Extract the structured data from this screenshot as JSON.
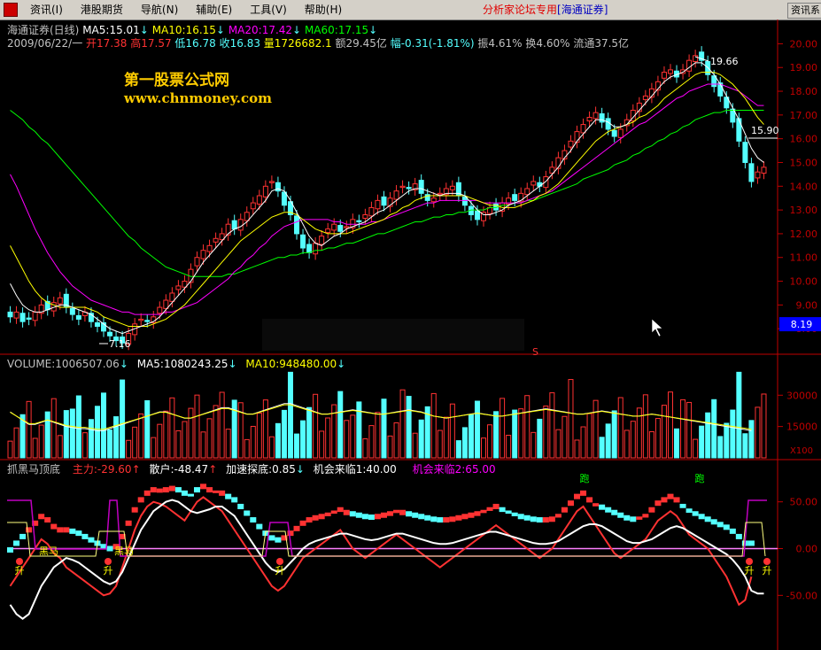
{
  "menu": {
    "items": [
      "资讯(I)",
      "港股期货",
      "导航(N)",
      "辅助(E)",
      "工具(V)",
      "帮助(H)"
    ],
    "title": "分析家论坛专用",
    "broker": "[海通证券]",
    "right_button": "资讯系"
  },
  "colors": {
    "up": "#ff3232",
    "down": "#54ffff",
    "ma5": "#ffffff",
    "ma10": "#ffff00",
    "ma20": "#ff00ff",
    "ma60": "#00ff00",
    "axis": "#c00000"
  },
  "price_header": {
    "name": "海通证券(日线)",
    "ma5": "MA5:15.01",
    "ma10": "MA10:16.15",
    "ma20": "MA20:17.42",
    "ma60": "MA60:17.15"
  },
  "quote_line": {
    "date": "2009/06/22/一",
    "open": "开17.38",
    "high": "高17.57",
    "low": "低16.78",
    "close": "收16.83",
    "vol": "量1726682.1",
    "amount": "额29.45亿",
    "change": "幅-0.31(-1.81%)",
    "amp": "振4.61%",
    "turn": "换4.60%",
    "float": "流通37.5亿"
  },
  "watermark": {
    "cn": "第一股票公式网",
    "url": "www.chnmoney.com"
  },
  "price_axis": {
    "labels": [
      "20.00",
      "19.00",
      "18.00",
      "17.00",
      "16.00",
      "15.00",
      "14.00",
      "13.00",
      "12.00",
      "11.00",
      "10.00",
      "9.00",
      "8.00"
    ],
    "current": "8.19"
  },
  "annotations": {
    "high": "19.66",
    "low": "7.16",
    "mid": "15.90",
    "s_mark": "S"
  },
  "volume_header": {
    "vol": "VOLUME:1006507.06",
    "ma5": "MA5:1080243.25",
    "ma10": "MA10:948480.00"
  },
  "volume_axis": {
    "labels": [
      "30000",
      "15000"
    ],
    "unit": "X100"
  },
  "ind_header": {
    "name": "抓黑马顶底",
    "main": "主力:-29.60",
    "retail": "散户:-48.47",
    "accel": "加速探底:0.85",
    "chance1": "机会来临1:40.00",
    "chance2": "机会来临2:65.00"
  },
  "ind_axis": {
    "labels": [
      "50.00",
      "0.00",
      "-50.00"
    ]
  },
  "ind_marks": {
    "sheng": "升",
    "heima": "黑马",
    "pao": "跑"
  },
  "chart_data": {
    "type": "candlestick",
    "y_range": [
      7.0,
      20.5
    ],
    "candles_close": [
      8.5,
      8.7,
      8.3,
      8.4,
      8.7,
      9.0,
      8.8,
      9.1,
      9.3,
      8.9,
      8.6,
      8.4,
      8.7,
      8.3,
      8.1,
      7.9,
      7.7,
      7.5,
      7.4,
      7.8,
      8.2,
      8.4,
      8.3,
      8.5,
      8.9,
      9.2,
      9.5,
      9.8,
      10.0,
      10.5,
      11.0,
      11.3,
      11.5,
      11.8,
      12.0,
      12.4,
      12.2,
      12.6,
      12.9,
      13.3,
      13.6,
      14.0,
      14.2,
      13.8,
      13.2,
      12.8,
      12.0,
      11.4,
      11.2,
      11.6,
      11.9,
      12.2,
      12.4,
      12.1,
      12.3,
      12.6,
      12.5,
      12.8,
      13.1,
      13.4,
      13.2,
      13.5,
      13.8,
      14.0,
      13.9,
      14.1,
      13.7,
      13.4,
      13.5,
      13.7,
      13.9,
      14.0,
      13.6,
      13.2,
      12.8,
      12.6,
      12.9,
      13.1,
      13.0,
      13.3,
      13.5,
      13.4,
      13.7,
      13.9,
      14.2,
      14.0,
      14.4,
      14.8,
      15.2,
      15.5,
      15.9,
      16.3,
      16.6,
      16.9,
      17.1,
      16.7,
      16.4,
      16.1,
      16.4,
      16.8,
      17.2,
      17.5,
      17.8,
      18.1,
      18.4,
      18.8,
      18.9,
      18.6,
      18.9,
      19.3,
      19.5,
      19.3,
      18.7,
      18.2,
      17.8,
      17.3,
      16.7,
      15.9,
      15.0,
      14.2,
      14.6,
      14.8
    ],
    "ma5": [
      9.9,
      9.4,
      9.0,
      8.8,
      8.7,
      8.7,
      8.8,
      8.9,
      9.0,
      9.0,
      8.9,
      8.8,
      8.7,
      8.6,
      8.4,
      8.2,
      8.0,
      7.9,
      7.8,
      7.9,
      8.0,
      8.1,
      8.2,
      8.3,
      8.5,
      8.8,
      9.1,
      9.4,
      9.7,
      10.0,
      10.4,
      10.8,
      11.1,
      11.4,
      11.7,
      12.0,
      12.2,
      12.3,
      12.5,
      12.8,
      13.1,
      13.4,
      13.8,
      13.9,
      13.8,
      13.4,
      12.9,
      12.4,
      11.9,
      11.6,
      11.5,
      11.7,
      11.9,
      12.0,
      12.2,
      12.3,
      12.4,
      12.5,
      12.7,
      12.9,
      13.0,
      13.2,
      13.4,
      13.6,
      13.8,
      13.9,
      13.9,
      13.8,
      13.7,
      13.6,
      13.7,
      13.7,
      13.7,
      13.6,
      13.3,
      13.0,
      12.8,
      12.8,
      12.9,
      13.0,
      13.2,
      13.3,
      13.4,
      13.6,
      13.8,
      14.0,
      14.2,
      14.5,
      14.8,
      15.2,
      15.5,
      15.9,
      16.2,
      16.5,
      16.8,
      16.8,
      16.7,
      16.5,
      16.5,
      16.6,
      16.9,
      17.2,
      17.5,
      17.8,
      18.1,
      18.4,
      18.6,
      18.7,
      18.8,
      19.0,
      19.2,
      19.2,
      19.0,
      18.7,
      18.3,
      17.8,
      17.3,
      16.8,
      16.2,
      15.6,
      15.2,
      15.0
    ],
    "ma10": [
      11.5,
      11.0,
      10.5,
      10.0,
      9.6,
      9.3,
      9.1,
      9.0,
      8.9,
      8.9,
      8.9,
      8.9,
      8.9,
      8.8,
      8.7,
      8.5,
      8.4,
      8.3,
      8.2,
      8.1,
      8.1,
      8.1,
      8.1,
      8.2,
      8.3,
      8.4,
      8.6,
      8.8,
      9.0,
      9.3,
      9.6,
      9.9,
      10.2,
      10.5,
      10.8,
      11.1,
      11.4,
      11.7,
      11.9,
      12.1,
      12.3,
      12.5,
      12.7,
      12.8,
      12.9,
      12.9,
      12.8,
      12.6,
      12.4,
      12.2,
      12.1,
      12.0,
      12.0,
      12.0,
      12.0,
      12.1,
      12.2,
      12.3,
      12.4,
      12.5,
      12.6,
      12.8,
      12.9,
      13.1,
      13.2,
      13.4,
      13.5,
      13.6,
      13.6,
      13.6,
      13.6,
      13.6,
      13.6,
      13.6,
      13.5,
      13.4,
      13.3,
      13.2,
      13.2,
      13.1,
      13.1,
      13.1,
      13.2,
      13.3,
      13.4,
      13.6,
      13.7,
      13.9,
      14.1,
      14.4,
      14.7,
      15.0,
      15.3,
      15.6,
      15.9,
      16.1,
      16.3,
      16.4,
      16.5,
      16.6,
      16.7,
      16.9,
      17.0,
      17.2,
      17.4,
      17.7,
      17.9,
      18.1,
      18.3,
      18.5,
      18.7,
      18.8,
      18.8,
      18.8,
      18.7,
      18.5,
      18.3,
      18.0,
      17.7,
      17.3,
      16.9,
      16.6
    ],
    "ma20": [
      14.5,
      14.0,
      13.4,
      12.8,
      12.2,
      11.7,
      11.2,
      10.8,
      10.4,
      10.1,
      9.8,
      9.6,
      9.4,
      9.2,
      9.1,
      9.0,
      8.9,
      8.8,
      8.7,
      8.7,
      8.6,
      8.6,
      8.6,
      8.6,
      8.6,
      8.7,
      8.7,
      8.8,
      8.9,
      9.0,
      9.1,
      9.3,
      9.5,
      9.7,
      9.9,
      10.1,
      10.4,
      10.6,
      10.9,
      11.1,
      11.4,
      11.6,
      11.9,
      12.1,
      12.3,
      12.4,
      12.5,
      12.6,
      12.6,
      12.6,
      12.6,
      12.6,
      12.5,
      12.5,
      12.4,
      12.4,
      12.4,
      12.4,
      12.5,
      12.5,
      12.6,
      12.7,
      12.8,
      12.9,
      13.0,
      13.1,
      13.2,
      13.3,
      13.3,
      13.4,
      13.4,
      13.4,
      13.4,
      13.4,
      13.4,
      13.4,
      13.3,
      13.3,
      13.3,
      13.3,
      13.3,
      13.3,
      13.3,
      13.4,
      13.5,
      13.6,
      13.7,
      13.8,
      14.0,
      14.2,
      14.4,
      14.6,
      14.8,
      15.0,
      15.2,
      15.4,
      15.6,
      15.8,
      16.0,
      16.2,
      16.4,
      16.6,
      16.7,
      16.9,
      17.1,
      17.3,
      17.5,
      17.7,
      17.8,
      18.0,
      18.1,
      18.2,
      18.3,
      18.3,
      18.3,
      18.2,
      18.1,
      18.0,
      17.8,
      17.6,
      17.4,
      17.4
    ],
    "ma60": [
      17.2,
      17.0,
      16.8,
      16.5,
      16.3,
      16.0,
      15.8,
      15.5,
      15.2,
      14.9,
      14.6,
      14.3,
      14.0,
      13.7,
      13.4,
      13.1,
      12.8,
      12.5,
      12.2,
      11.9,
      11.7,
      11.4,
      11.2,
      11.0,
      10.8,
      10.6,
      10.5,
      10.4,
      10.3,
      10.2,
      10.2,
      10.2,
      10.2,
      10.2,
      10.2,
      10.3,
      10.3,
      10.4,
      10.5,
      10.6,
      10.7,
      10.8,
      10.9,
      11.0,
      11.0,
      11.1,
      11.1,
      11.2,
      11.2,
      11.3,
      11.3,
      11.4,
      11.4,
      11.5,
      11.6,
      11.6,
      11.7,
      11.8,
      11.9,
      12.0,
      12.0,
      12.1,
      12.2,
      12.3,
      12.4,
      12.5,
      12.5,
      12.6,
      12.7,
      12.7,
      12.8,
      12.8,
      12.9,
      12.9,
      13.0,
      13.0,
      13.0,
      13.1,
      13.1,
      13.2,
      13.2,
      13.3,
      13.3,
      13.4,
      13.4,
      13.5,
      13.6,
      13.7,
      13.8,
      13.9,
      14.0,
      14.1,
      14.3,
      14.4,
      14.5,
      14.6,
      14.7,
      14.9,
      15.0,
      15.1,
      15.3,
      15.4,
      15.6,
      15.7,
      15.9,
      16.0,
      16.2,
      16.3,
      16.5,
      16.6,
      16.8,
      16.9,
      17.0,
      17.1,
      17.1,
      17.2,
      17.2,
      17.2,
      17.2,
      17.2,
      17.2,
      17.2
    ],
    "volume_range": [
      0,
      42000
    ],
    "volume_ma5": [
      22000,
      20000,
      18000,
      16000,
      16000,
      17000,
      18000,
      17000,
      16000,
      15000,
      14500,
      14000,
      14000,
      13500,
      13000,
      13000,
      14000,
      15000,
      16000,
      17000,
      18000,
      19000,
      20000,
      21000,
      22000,
      22000,
      21000,
      20000,
      19000,
      19000,
      20000,
      21000,
      22000,
      23000,
      24000,
      24000,
      23000,
      22000,
      21000,
      21000,
      22000,
      23000,
      24000,
      25000,
      26000,
      26000,
      25000,
      24000,
      23000,
      22000,
      21000,
      21000,
      21500,
      22000,
      22500,
      23000,
      22500,
      22000,
      21500,
      21000,
      21000,
      21500,
      22000,
      22500,
      23000,
      22500,
      22000,
      21000,
      20000,
      19500,
      19000,
      19500,
      20000,
      20500,
      21000,
      21500,
      21000,
      20500,
      20000,
      20000,
      20500,
      21000,
      21500,
      22000,
      22500,
      23000,
      23500,
      23000,
      22500,
      22000,
      21500,
      21000,
      21000,
      21500,
      22000,
      22500,
      22000,
      21500,
      21000,
      20500,
      20000,
      20000,
      20500,
      21000,
      20500,
      20000,
      19500,
      19000,
      18500,
      18000,
      17500,
      17000,
      16500,
      16000,
      15500,
      15000,
      14500,
      14000,
      13500,
      13000
    ],
    "ind_range": [
      -80,
      80
    ],
    "ind_main": [
      -40,
      -30,
      -20,
      -10,
      0,
      10,
      5,
      -5,
      -10,
      -20,
      -25,
      -30,
      -35,
      -40,
      -45,
      -50,
      -48,
      -40,
      -20,
      0,
      20,
      35,
      45,
      50,
      48,
      45,
      40,
      35,
      30,
      40,
      50,
      55,
      50,
      45,
      40,
      30,
      20,
      10,
      0,
      -10,
      -20,
      -30,
      -40,
      -45,
      -40,
      -30,
      -20,
      -10,
      -5,
      0,
      5,
      10,
      15,
      20,
      10,
      0,
      -5,
      -10,
      -5,
      0,
      5,
      10,
      15,
      10,
      5,
      0,
      -5,
      -10,
      -15,
      -20,
      -15,
      -10,
      -5,
      0,
      5,
      10,
      15,
      20,
      25,
      20,
      15,
      10,
      5,
      0,
      -5,
      -10,
      -5,
      0,
      10,
      20,
      30,
      40,
      45,
      35,
      25,
      15,
      5,
      -5,
      -10,
      -5,
      0,
      5,
      10,
      20,
      30,
      35,
      40,
      35,
      25,
      15,
      10,
      5,
      0,
      -10,
      -20,
      -30,
      -45,
      -60,
      -55,
      -30
    ],
    "ind_retail": [
      -60,
      -70,
      -75,
      -70,
      -55,
      -40,
      -30,
      -20,
      -15,
      -10,
      -12,
      -15,
      -20,
      -25,
      -30,
      -35,
      -38,
      -35,
      -25,
      -10,
      5,
      20,
      30,
      40,
      45,
      50,
      52,
      50,
      45,
      40,
      38,
      40,
      42,
      45,
      45,
      40,
      35,
      25,
      15,
      5,
      -5,
      -15,
      -22,
      -25,
      -22,
      -15,
      -8,
      0,
      5,
      8,
      10,
      12,
      14,
      16,
      16,
      14,
      12,
      10,
      9,
      10,
      12,
      14,
      16,
      16,
      14,
      12,
      10,
      8,
      6,
      5,
      5,
      6,
      8,
      10,
      12,
      14,
      16,
      18,
      18,
      16,
      14,
      12,
      10,
      8,
      6,
      5,
      5,
      6,
      8,
      12,
      16,
      20,
      24,
      26,
      26,
      24,
      20,
      16,
      12,
      8,
      6,
      6,
      8,
      10,
      14,
      18,
      22,
      24,
      22,
      18,
      14,
      10,
      6,
      2,
      -2,
      -6,
      -12,
      -20,
      -30,
      -45,
      -48,
      -48
    ]
  }
}
